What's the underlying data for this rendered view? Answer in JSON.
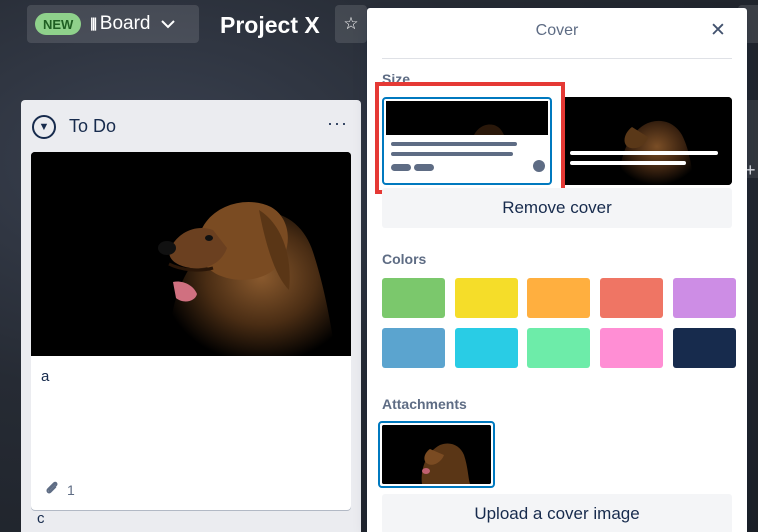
{
  "header": {
    "new_badge": "NEW",
    "view_icon": "board-view-icon",
    "view_label": "Board",
    "board_title": "Project X"
  },
  "list": {
    "title": "To Do",
    "cards": [
      {
        "title": "a",
        "attachment_count": "1"
      }
    ],
    "next_card_peek": "c"
  },
  "cover_popover": {
    "title": "Cover",
    "size_label": "Size",
    "remove_cover_label": "Remove cover",
    "colors_label": "Colors",
    "colors": [
      "#7bc86c",
      "#f5dd29",
      "#ffaf3f",
      "#ef7564",
      "#cd8de5",
      "#5ba4cf",
      "#29cce5",
      "#6deca9",
      "#ff8ed4",
      "#172b4d"
    ],
    "attachments_label": "Attachments",
    "upload_label": "Upload a cover image"
  },
  "accent": "#0079bf",
  "highlight_color": "#e53935"
}
